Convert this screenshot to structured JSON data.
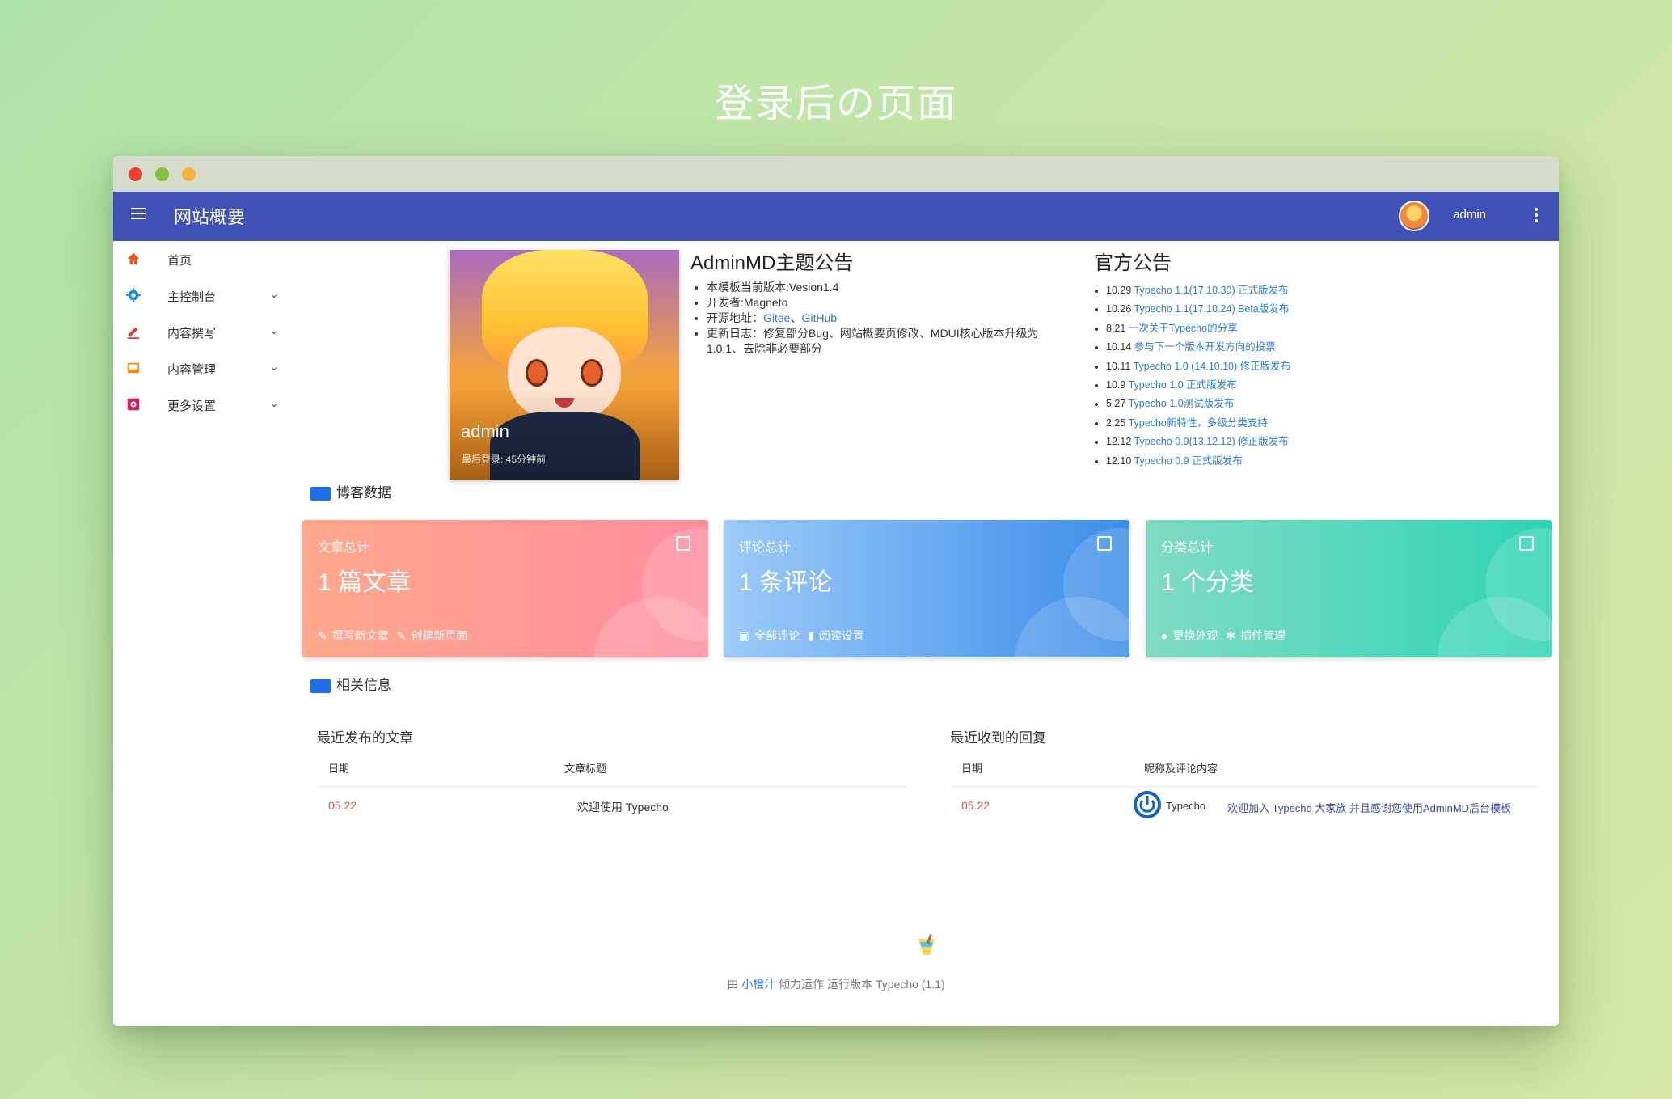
{
  "page_heading": "登录后の页面",
  "appbar": {
    "title": "网站概要",
    "user": "admin"
  },
  "sidebar": {
    "items": [
      {
        "label": "首页",
        "icon": "home-icon",
        "color": "#f4511e"
      },
      {
        "label": "主控制台",
        "icon": "gear-icon",
        "color": "#1e88e5"
      },
      {
        "label": "内容撰写",
        "icon": "pencil-icon",
        "color": "#e53935"
      },
      {
        "label": "内容管理",
        "icon": "inbox-icon",
        "color": "#fb8c00"
      },
      {
        "label": "更多设置",
        "icon": "settings-box-icon",
        "color": "#d81b60"
      }
    ]
  },
  "profile": {
    "name": "admin",
    "last_login": "最后登录: 45分钟前"
  },
  "notice": {
    "title": "AdminMD主题公告",
    "version": "本模板当前版本:Vesion1.4",
    "developer": "开发者:Magneto",
    "repo_prefix": "开源地址：",
    "repo_gitee": "Gitee",
    "repo_sep": "、",
    "repo_github": "GitHub",
    "changelog": "更新日志：修复部分Bug、网站概要页修改、MDUI核心版本升级为1.0.1、去除非必要部分"
  },
  "official": {
    "title": "官方公告",
    "items": [
      {
        "date": "10.29",
        "text": "Typecho 1.1(17.10.30) 正式版发布"
      },
      {
        "date": "10.26",
        "text": "Typecho 1.1(17.10.24) Beta版发布"
      },
      {
        "date": "8.21",
        "text": "一次关于Typecho的分享"
      },
      {
        "date": "10.14",
        "text": "参与下一个版本开发方向的投票"
      },
      {
        "date": "10.11",
        "text": "Typecho 1.0 (14.10.10) 修正版发布"
      },
      {
        "date": "10.9",
        "text": "Typecho 1.0 正式版发布"
      },
      {
        "date": "5.27",
        "text": "Typecho 1.0测试版发布"
      },
      {
        "date": "2.25",
        "text": "Typecho新特性，多级分类支持"
      },
      {
        "date": "12.12",
        "text": "Typecho 0.9(13.12.12) 修正版发布"
      },
      {
        "date": "12.10",
        "text": "Typecho 0.9 正式版发布"
      }
    ]
  },
  "sections": {
    "blog_data": "博客数据",
    "related_info": "相关信息"
  },
  "stats": [
    {
      "label": "文章总计",
      "value": "1 篇文章",
      "link1": "撰写新文章",
      "link2": "创建新页面",
      "icon": "articles-icon"
    },
    {
      "label": "评论总计",
      "value": "1 条评论",
      "link1": "全部评论",
      "link2": "阅读设置",
      "icon": "comment-icon"
    },
    {
      "label": "分类总计",
      "value": "1 个分类",
      "link1": "更换外观",
      "link2": "插件管理",
      "icon": "layers-icon"
    }
  ],
  "recent_posts": {
    "title": "最近发布的文章",
    "col_date": "日期",
    "col_title": "文章标题",
    "rows": [
      {
        "date": "05.22",
        "title": "欢迎使用 Typecho"
      }
    ]
  },
  "recent_replies": {
    "title": "最近收到的回复",
    "col_date": "日期",
    "col_content": "昵称及评论内容",
    "rows": [
      {
        "date": "05.22",
        "author": "Typecho",
        "content": "欢迎加入 Typecho 大家族 并且感谢您使用AdminMD后台模板"
      }
    ]
  },
  "footer": {
    "prefix": "由",
    "brand": "小橙汁",
    "suffix": "倾力运作 运行版本 Typecho (1.1)"
  }
}
